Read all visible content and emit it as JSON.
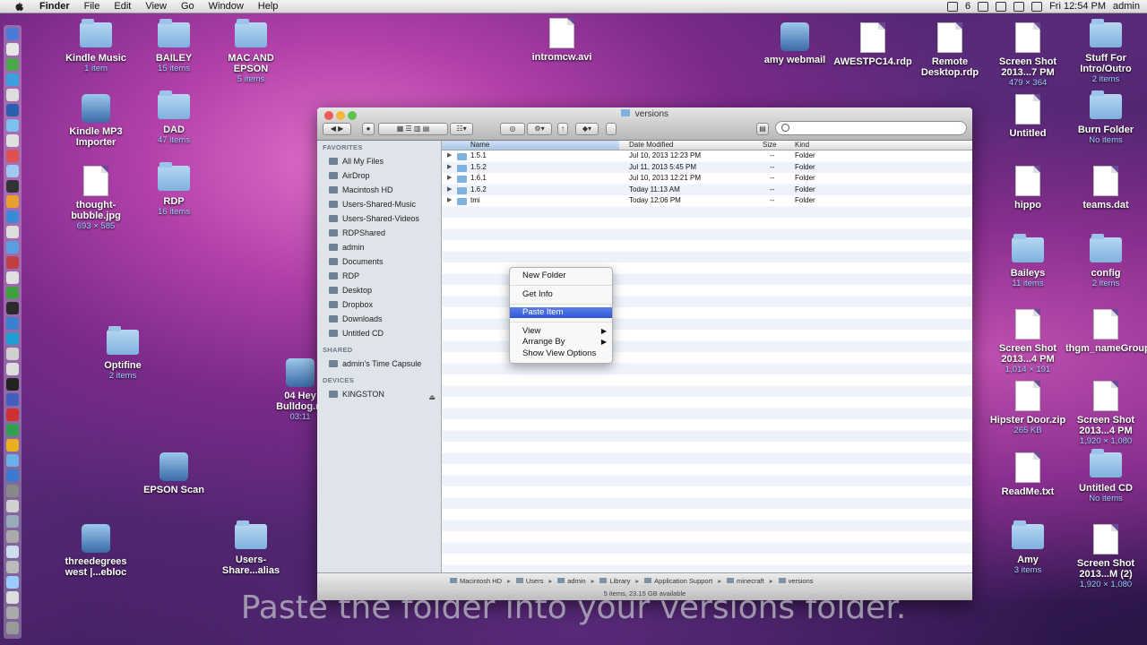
{
  "menubar": {
    "app": "Finder",
    "items": [
      "File",
      "Edit",
      "View",
      "Go",
      "Window",
      "Help"
    ],
    "status_number": "6",
    "clock": "Fri 12:54 PM",
    "user": "admin"
  },
  "desktop_left": [
    {
      "label": "Kindle Music",
      "sub": "1 item",
      "type": "folder"
    },
    {
      "label": "BAILEY",
      "sub": "15 items",
      "type": "folder"
    },
    {
      "label": "MAC AND EPSON",
      "sub": "5 items",
      "type": "folder"
    },
    {
      "label": "Kindle MP3 Importer",
      "sub": "",
      "type": "app"
    },
    {
      "label": "DAD",
      "sub": "47 items",
      "type": "folder"
    },
    {
      "label": "thought-bubble.jpg",
      "sub": "693 × 585",
      "type": "doc"
    },
    {
      "label": "RDP",
      "sub": "16 items",
      "type": "folder"
    },
    {
      "label": "Optifine",
      "sub": "2 items",
      "type": "folder"
    },
    {
      "label": "EPSON Scan",
      "sub": "",
      "type": "app"
    },
    {
      "label": "threedegrees west |...ebloc",
      "sub": "",
      "type": "app"
    },
    {
      "label": "Users-Share...alias",
      "sub": "",
      "type": "folder"
    },
    {
      "label": "intromcw.avi",
      "sub": "",
      "type": "doc"
    },
    {
      "label": "04 Hey Bulldog.m",
      "sub": "03:11",
      "type": "app"
    }
  ],
  "desktop_right": [
    {
      "label": "amy webmail",
      "sub": "",
      "type": "app"
    },
    {
      "label": "AWESTPC14.rdp",
      "sub": "",
      "type": "doc"
    },
    {
      "label": "Remote Desktop.rdp",
      "sub": "",
      "type": "doc"
    },
    {
      "label": "Screen Shot 2013...7 PM",
      "sub": "479 × 364",
      "type": "doc"
    },
    {
      "label": "Stuff For Intro/Outro",
      "sub": "2 items",
      "type": "folder"
    },
    {
      "label": "Untitled",
      "sub": "",
      "type": "doc"
    },
    {
      "label": "Burn Folder",
      "sub": "No items",
      "type": "folder"
    },
    {
      "label": "hippo",
      "sub": "",
      "type": "doc"
    },
    {
      "label": "teams.dat",
      "sub": "",
      "type": "doc"
    },
    {
      "label": "Baileys",
      "sub": "11 items",
      "type": "folder"
    },
    {
      "label": "config",
      "sub": "2 items",
      "type": "folder"
    },
    {
      "label": "Screen Shot 2013...4 PM",
      "sub": "1,014 × 191",
      "type": "doc"
    },
    {
      "label": "thgm_nameGroups.txt",
      "sub": "",
      "type": "doc"
    },
    {
      "label": "Hipster Door.zip",
      "sub": "265 KB",
      "type": "doc"
    },
    {
      "label": "Screen Shot 2013...4 PM",
      "sub": "1,920 × 1,080",
      "type": "doc"
    },
    {
      "label": "ReadMe.txt",
      "sub": "",
      "type": "doc"
    },
    {
      "label": "Untitled CD",
      "sub": "No items",
      "type": "folder"
    },
    {
      "label": "Amy",
      "sub": "3 items",
      "type": "folder"
    },
    {
      "label": "Screen Shot 2013...M (2)",
      "sub": "1,920 × 1,080",
      "type": "doc"
    }
  ],
  "window": {
    "title": "versions",
    "sidebar": {
      "favorites_heading": "FAVORITES",
      "favorites": [
        "All My Files",
        "AirDrop",
        "Macintosh HD",
        "Users-Shared-Music",
        "Users-Shared-Videos",
        "RDPShared",
        "admin",
        "Documents",
        "RDP",
        "Desktop",
        "Dropbox",
        "Downloads",
        "Untitled CD"
      ],
      "shared_heading": "SHARED",
      "shared": [
        "admin's Time Capsule"
      ],
      "devices_heading": "DEVICES",
      "devices": [
        "KINGSTON"
      ]
    },
    "columns": {
      "name": "Name",
      "date": "Date Modified",
      "size": "Size",
      "kind": "Kind"
    },
    "rows": [
      {
        "name": "1.5.1",
        "date": "Jul 10, 2013 12:23 PM",
        "size": "--",
        "kind": "Folder"
      },
      {
        "name": "1.5.2",
        "date": "Jul 11, 2013 5:45 PM",
        "size": "--",
        "kind": "Folder"
      },
      {
        "name": "1.6.1",
        "date": "Jul 10, 2013 12:21 PM",
        "size": "--",
        "kind": "Folder"
      },
      {
        "name": "1.6.2",
        "date": "Today 11:13 AM",
        "size": "--",
        "kind": "Folder"
      },
      {
        "name": "tmi",
        "date": "Today 12:06 PM",
        "size": "--",
        "kind": "Folder"
      }
    ],
    "path": [
      "Macintosh HD",
      "Users",
      "admin",
      "Library",
      "Application Support",
      "minecraft",
      "versions"
    ],
    "status": "5 items, 23.15 GB available"
  },
  "context_menu": {
    "new_folder": "New Folder",
    "get_info": "Get Info",
    "paste_item": "Paste Item",
    "view": "View",
    "arrange_by": "Arrange By",
    "show_view_options": "Show View Options"
  },
  "caption": "Paste the folder into your versions folder."
}
